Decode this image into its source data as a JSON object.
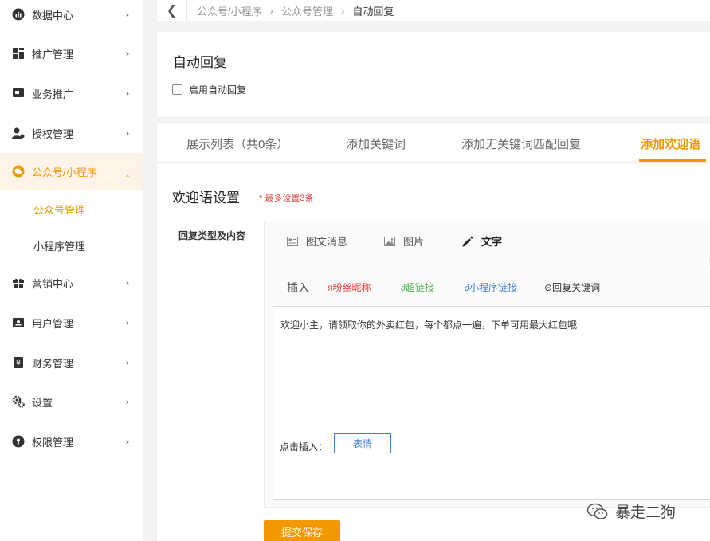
{
  "sidebar": {
    "items": [
      {
        "label": "数据中心",
        "icon": "chart-circle-icon"
      },
      {
        "label": "推广管理",
        "icon": "grid-icon"
      },
      {
        "label": "业务推广",
        "icon": "monitor-icon"
      },
      {
        "label": "授权管理",
        "icon": "user-auth-icon"
      },
      {
        "label": "公众号/小程序",
        "icon": "wechat-icon"
      },
      {
        "label": "营销中心",
        "icon": "gift-icon"
      },
      {
        "label": "用户管理",
        "icon": "id-card-icon"
      },
      {
        "label": "财务管理",
        "icon": "yen-icon"
      },
      {
        "label": "设置",
        "icon": "gear-icon"
      },
      {
        "label": "权限管理",
        "icon": "shield-icon"
      }
    ],
    "subitems": [
      {
        "label": "公众号管理"
      },
      {
        "label": "小程序管理"
      }
    ]
  },
  "breadcrumb": {
    "items": [
      "公众号/小程序",
      "公众号管理",
      "自动回复"
    ]
  },
  "page": {
    "title": "自动回复",
    "enable_label": "启用自动回复"
  },
  "tabs": [
    {
      "label": "展示列表（共0条）"
    },
    {
      "label": "添加关键词"
    },
    {
      "label": "添加无关键词匹配回复"
    },
    {
      "label": "添加欢迎语"
    }
  ],
  "section": {
    "title": "欢迎语设置",
    "note": "* 最多设置3条",
    "field_label": "回复类型及内容"
  },
  "reply_types": [
    {
      "label": "图文消息"
    },
    {
      "label": "图片"
    },
    {
      "label": "文字"
    }
  ],
  "insert": {
    "label": "插入",
    "options": [
      {
        "label": "粉丝昵称"
      },
      {
        "label": "超链接"
      },
      {
        "label": "小程序链接"
      },
      {
        "label": "回复关键词"
      }
    ]
  },
  "editor": {
    "content": "欢迎小主，请领取你的外卖红包，每个都点一遍，下单可用最大红包哦",
    "click_insert_label": "点击插入：",
    "emoji_button": "表情"
  },
  "submit_label": "提交保存",
  "watermark": "暴走二狗",
  "colors": {
    "accent": "#f39800",
    "link_red": "#e53935",
    "link_green": "#4caf50",
    "link_blue": "#3f7fd6"
  }
}
